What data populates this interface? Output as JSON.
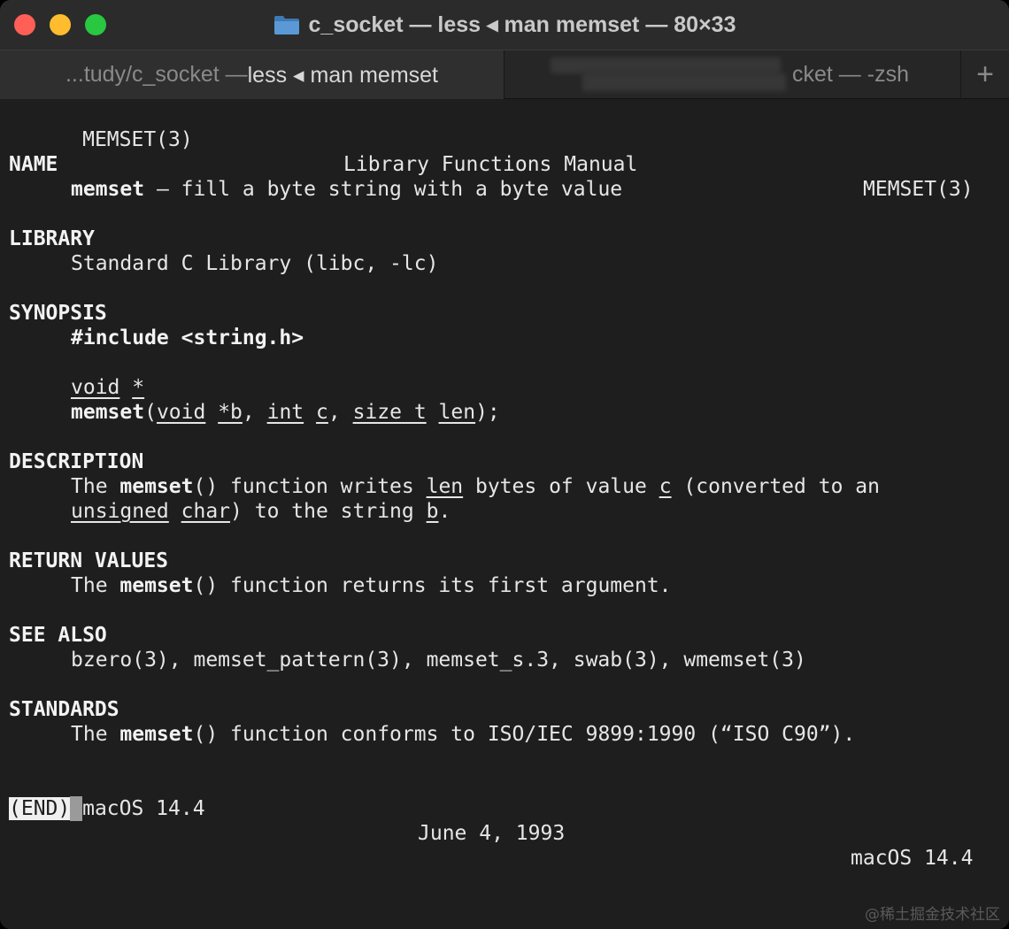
{
  "window": {
    "title": "c_socket — less ◂ man memset — 80×33"
  },
  "tabs": [
    {
      "label_dim": "...tudy/c_socket — ",
      "label_strong": "less ◂ man memset"
    },
    {
      "label": "cket — -zsh"
    }
  ],
  "new_tab_symbol": "+",
  "man": {
    "header_left": "MEMSET(3)",
    "header_center": "Library Functions Manual",
    "header_right": "MEMSET(3)",
    "name_heading": "NAME",
    "name_func": "memset",
    "name_desc": " – fill a byte string with a byte value",
    "library_heading": "LIBRARY",
    "library_text": "Standard C Library (libc, -lc)",
    "synopsis_heading": "SYNOPSIS",
    "include": "#include <string.h>",
    "ret_type": "void",
    "ret_ptr": "*",
    "proto_func": "memset",
    "proto_open": "(",
    "p1_type": "void",
    "p1_name": "*b",
    "comma": ", ",
    "p2_type": "int",
    "p2_name": "c",
    "p3_type": "size_t",
    "p3_name": "len",
    "proto_close": ");",
    "description_heading": "DESCRIPTION",
    "desc_the": "The ",
    "desc_func": "memset",
    "desc_t1": "() function writes ",
    "desc_len": "len",
    "desc_t2": " bytes of value ",
    "desc_c": "c",
    "desc_t3": " (converted to an",
    "desc_unsigned": "unsigned",
    "desc_char": "char",
    "desc_t4": ") to the string ",
    "desc_b": "b",
    "desc_t5": ".",
    "return_heading": "RETURN VALUES",
    "ret_the": "The ",
    "ret_func": "memset",
    "ret_text": "() function returns its first argument.",
    "seealso_heading": "SEE ALSO",
    "seealso_text": "bzero(3), memset_pattern(3), memset_s.3, swab(3), wmemset(3)",
    "standards_heading": "STANDARDS",
    "std_the": "The ",
    "std_func": "memset",
    "std_text": "() function conforms to ISO/IEC 9899:1990 (“ISO C90”).",
    "footer_left": "macOS 14.4",
    "footer_center": "June 4, 1993",
    "footer_right": "macOS 14.4",
    "end_prompt": "(END)"
  },
  "watermark": "@稀土掘金技术社区",
  "colors": {
    "close": "#ff5f57",
    "minimize": "#febc2e",
    "zoom": "#28c840",
    "background": "#1e1e1e",
    "text": "#e6e6e6"
  }
}
